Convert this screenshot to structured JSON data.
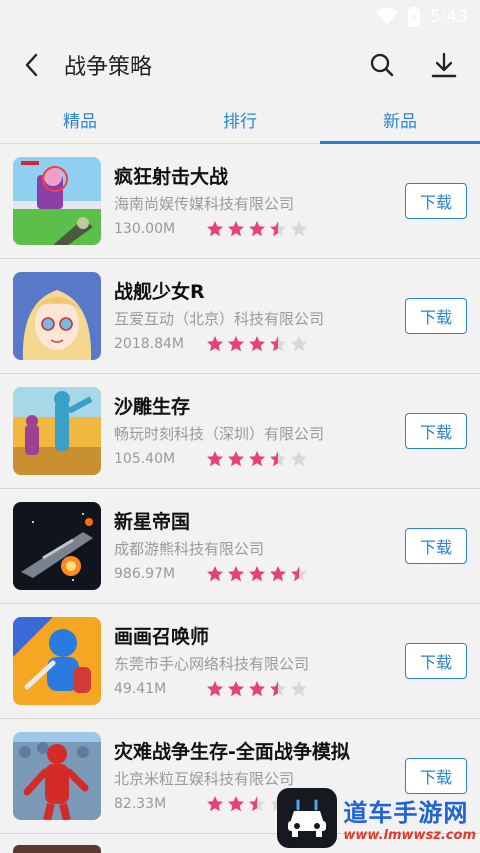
{
  "status": {
    "time": "5:43"
  },
  "header": {
    "title": "战争策略"
  },
  "tabs": [
    {
      "label": "精品"
    },
    {
      "label": "排行"
    },
    {
      "label": "新品"
    }
  ],
  "active_tab": "新品",
  "items": [
    {
      "name": "疯狂射击大战",
      "company": "海南尚娱传媒科技有限公司",
      "size": "130.00M",
      "rating": 3.5,
      "button": "下载"
    },
    {
      "name": "战舰少女R",
      "company": "互爱互动（北京）科技有限公司",
      "size": "2018.84M",
      "rating": 3.5,
      "button": "下载"
    },
    {
      "name": "沙雕生存",
      "company": "畅玩时刻科技（深圳）有限公司",
      "size": "105.40M",
      "rating": 3.5,
      "button": "下载"
    },
    {
      "name": "新星帝国",
      "company": "成都游熊科技有限公司",
      "size": "986.97M",
      "rating": 4.5,
      "button": "下载"
    },
    {
      "name": "画画召唤师",
      "company": "东莞市手心网络科技有限公司",
      "size": "49.41M",
      "rating": 3.5,
      "button": "下载"
    },
    {
      "name": "灾难战争生存-全面战争模拟",
      "company": "北京米粒互娱科技有限公司",
      "size": "82.33M",
      "rating": 2.5,
      "button": "下载"
    }
  ],
  "watermark": {
    "title": "道车手游网",
    "url": "www.lmwwsz.com"
  },
  "colors": {
    "accent": "#1e7fd8",
    "star": "#e8407a",
    "star_empty": "#d8d8d8"
  }
}
